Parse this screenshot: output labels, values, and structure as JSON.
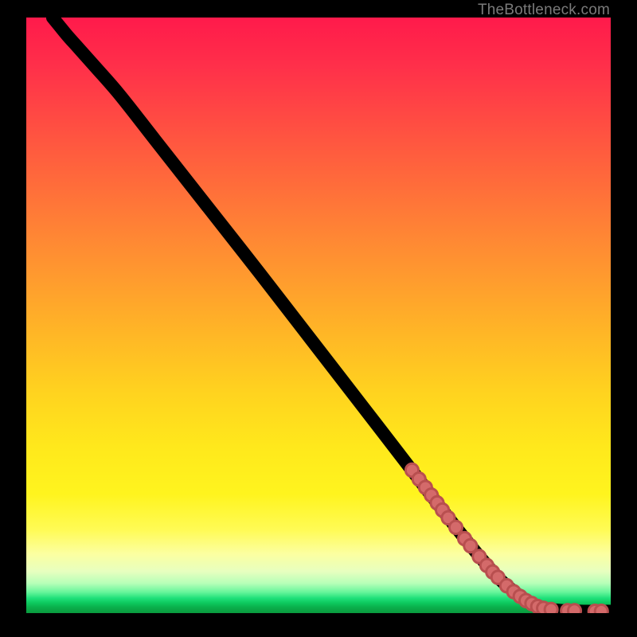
{
  "watermark": "TheBottleneck.com",
  "chart_data": {
    "type": "line",
    "title": "",
    "xlabel": "",
    "ylabel": "",
    "xlim": [
      0,
      100
    ],
    "ylim": [
      0,
      100
    ],
    "grid": false,
    "legend": false,
    "background": "vertical red-to-green gradient",
    "curve_comment": "Monotone decreasing curve; starts top-left, slight convex shoulder, long near-linear diagonal, then eases into a flat tail near y=0 on the right.",
    "curve": [
      {
        "x": 4.5,
        "y": 100.0
      },
      {
        "x": 5.5,
        "y": 98.8
      },
      {
        "x": 7.0,
        "y": 97.0
      },
      {
        "x": 9.0,
        "y": 94.8
      },
      {
        "x": 12.0,
        "y": 91.5
      },
      {
        "x": 16.0,
        "y": 87.0
      },
      {
        "x": 22.0,
        "y": 79.5
      },
      {
        "x": 30.0,
        "y": 69.5
      },
      {
        "x": 40.0,
        "y": 57.0
      },
      {
        "x": 50.0,
        "y": 44.3
      },
      {
        "x": 60.0,
        "y": 31.6
      },
      {
        "x": 68.0,
        "y": 21.4
      },
      {
        "x": 74.0,
        "y": 13.8
      },
      {
        "x": 78.0,
        "y": 9.0
      },
      {
        "x": 81.0,
        "y": 5.7
      },
      {
        "x": 83.5,
        "y": 3.6
      },
      {
        "x": 85.5,
        "y": 2.2
      },
      {
        "x": 87.0,
        "y": 1.3
      },
      {
        "x": 89.0,
        "y": 0.7
      },
      {
        "x": 92.0,
        "y": 0.4
      },
      {
        "x": 96.0,
        "y": 0.3
      },
      {
        "x": 100.0,
        "y": 0.3
      }
    ],
    "series": [
      {
        "name": "markers",
        "type": "scatter",
        "color": "#d46a6a",
        "radius": 1.1,
        "points_comment": "Salmon dots along the lower-right section of the curve only.",
        "points": [
          {
            "x": 66.0,
            "y": 24.0
          },
          {
            "x": 67.2,
            "y": 22.5
          },
          {
            "x": 68.3,
            "y": 21.1
          },
          {
            "x": 69.3,
            "y": 19.8
          },
          {
            "x": 70.3,
            "y": 18.5
          },
          {
            "x": 71.2,
            "y": 17.3
          },
          {
            "x": 72.2,
            "y": 16.0
          },
          {
            "x": 73.5,
            "y": 14.4
          },
          {
            "x": 75.0,
            "y": 12.5
          },
          {
            "x": 76.0,
            "y": 11.3
          },
          {
            "x": 77.5,
            "y": 9.5
          },
          {
            "x": 78.8,
            "y": 8.0
          },
          {
            "x": 79.8,
            "y": 6.9
          },
          {
            "x": 80.7,
            "y": 6.0
          },
          {
            "x": 82.2,
            "y": 4.6
          },
          {
            "x": 83.4,
            "y": 3.6
          },
          {
            "x": 84.5,
            "y": 2.8
          },
          {
            "x": 85.5,
            "y": 2.1
          },
          {
            "x": 86.5,
            "y": 1.6
          },
          {
            "x": 87.5,
            "y": 1.1
          },
          {
            "x": 88.5,
            "y": 0.8
          },
          {
            "x": 89.8,
            "y": 0.6
          },
          {
            "x": 92.6,
            "y": 0.4
          },
          {
            "x": 93.8,
            "y": 0.4
          },
          {
            "x": 97.3,
            "y": 0.3
          },
          {
            "x": 98.4,
            "y": 0.3
          }
        ]
      }
    ]
  }
}
